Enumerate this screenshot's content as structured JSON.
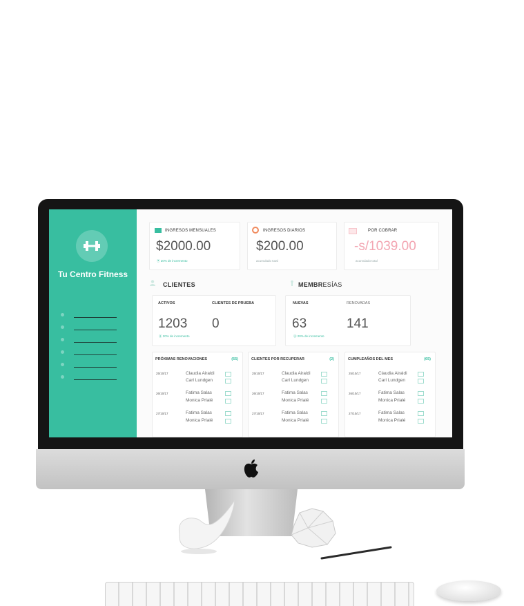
{
  "app": {
    "brand": "Tu Centro Fitness",
    "accent_color": "#38bea0",
    "logo_icon": "dumbbell-icon"
  },
  "sidebar": {
    "items": [
      {
        "icon": "menu-dot-icon"
      },
      {
        "icon": "menu-dot-icon"
      },
      {
        "icon": "menu-dot-icon"
      },
      {
        "icon": "menu-dot-icon"
      },
      {
        "icon": "menu-dot-icon"
      }
    ]
  },
  "stats": {
    "monthly": {
      "label": "INGRESOS MENSUALES",
      "value": "$2000.00",
      "sub": "⦿ 20% de incremento",
      "icon": "cash-icon"
    },
    "daily": {
      "label": "INGRESOS DIARIOS",
      "value": "$200.00",
      "sub": "acumulado total",
      "icon": "target-icon"
    },
    "receivable": {
      "label": "POR COBRAR",
      "value": "-s/1039.00",
      "sub": "acumulado total",
      "icon": "invoice-icon",
      "value_color": "#f3a6b2"
    }
  },
  "clients": {
    "title": "CLIENTES",
    "active_label": "ACTIVOS",
    "active_value": "1203",
    "trial_label": "CLIENTES DE PRUEBA",
    "trial_value": "0",
    "sub": "⦿ 20% de incremento"
  },
  "memberships": {
    "title_bold": "MEMBR",
    "title_light": "ESÍAS",
    "new_label": "NUEVAS",
    "new_value": "63",
    "renewed_label": "RENOVADAS",
    "renewed_value": "141",
    "sub": "⦿ 20% de incremento"
  },
  "lists": [
    {
      "title": "PRÓXIMAS RENOVACIONES",
      "count": "(65)",
      "rows": [
        {
          "date": "25/10/17",
          "names": [
            "Claudia Airaldi",
            "Carl Lundgen"
          ]
        },
        {
          "date": "26/10/17",
          "names": [
            "Fatima Salas",
            "Monica Prialé"
          ]
        },
        {
          "date": "27/10/17",
          "names": [
            "Fatima Salas",
            "Monica Prialé"
          ]
        }
      ]
    },
    {
      "title": "CLIENTES POR RECUPERAR",
      "count": "(2)",
      "rows": [
        {
          "date": "25/10/17",
          "names": [
            "Claudia Airaldi",
            "Carl Lundgen"
          ]
        },
        {
          "date": "26/10/17",
          "names": [
            "Fatima Salas",
            "Monica Prialé"
          ]
        },
        {
          "date": "27/10/17",
          "names": [
            "Fatima Salas",
            "Monica Prialé"
          ]
        }
      ]
    },
    {
      "title": "CUMPLEAÑOS DEL MES",
      "count": "(65)",
      "rows": [
        {
          "date": "25/10/17",
          "names": [
            "Claudia Airaldi",
            "Carl Lundgen"
          ]
        },
        {
          "date": "26/10/17",
          "names": [
            "Fatima Salas",
            "Monica Prialé"
          ]
        },
        {
          "date": "27/10/17",
          "names": [
            "Fatima Salas",
            "Monica Prialé"
          ]
        }
      ]
    }
  ]
}
